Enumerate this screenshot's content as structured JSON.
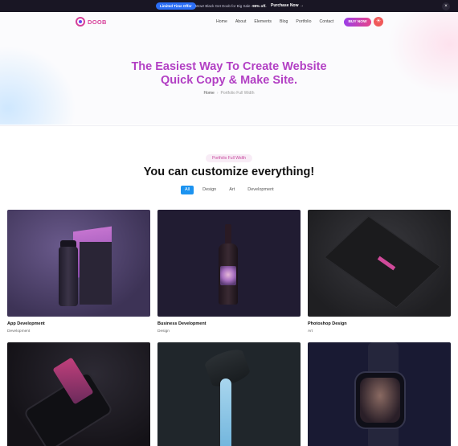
{
  "topbar": {
    "badge": "Limited Time Offer",
    "text_prefix": "Wow! Black Get Doob for Big Sale ",
    "text_highlight": "-95% off.",
    "link": "Purchase Now",
    "link_arrow": "→",
    "close": "×"
  },
  "header": {
    "logo": "DOOB",
    "nav": [
      "Home",
      "About",
      "Elements",
      "Blog",
      "Portfolio",
      "Contact"
    ],
    "buy_button": "BUY NOW",
    "theme_icon": "☀"
  },
  "hero": {
    "title_line1": "The Easiest Way To Create Website",
    "title_line2": "Quick Copy & Make Site.",
    "breadcrumb": {
      "home": "Home",
      "separator": "›",
      "current": "Portfolio Full Width"
    }
  },
  "section": {
    "pill": "Portfolio Full Width",
    "title": "You can customize everything!",
    "filters": [
      "All",
      "Design",
      "Art",
      "Development"
    ],
    "active_filter": "All"
  },
  "portfolio": [
    {
      "title": "App Development",
      "category": "Development"
    },
    {
      "title": "Business Development",
      "category": "Design"
    },
    {
      "title": "Photoshop Design",
      "category": "Art"
    },
    {
      "title": "",
      "category": ""
    },
    {
      "title": "",
      "category": ""
    },
    {
      "title": "",
      "category": ""
    }
  ],
  "colors": {
    "accent": "#b23fc4",
    "filter_active": "#1c93f0",
    "buy_gradient_start": "#9b3ee8",
    "buy_gradient_end": "#e7448a"
  }
}
